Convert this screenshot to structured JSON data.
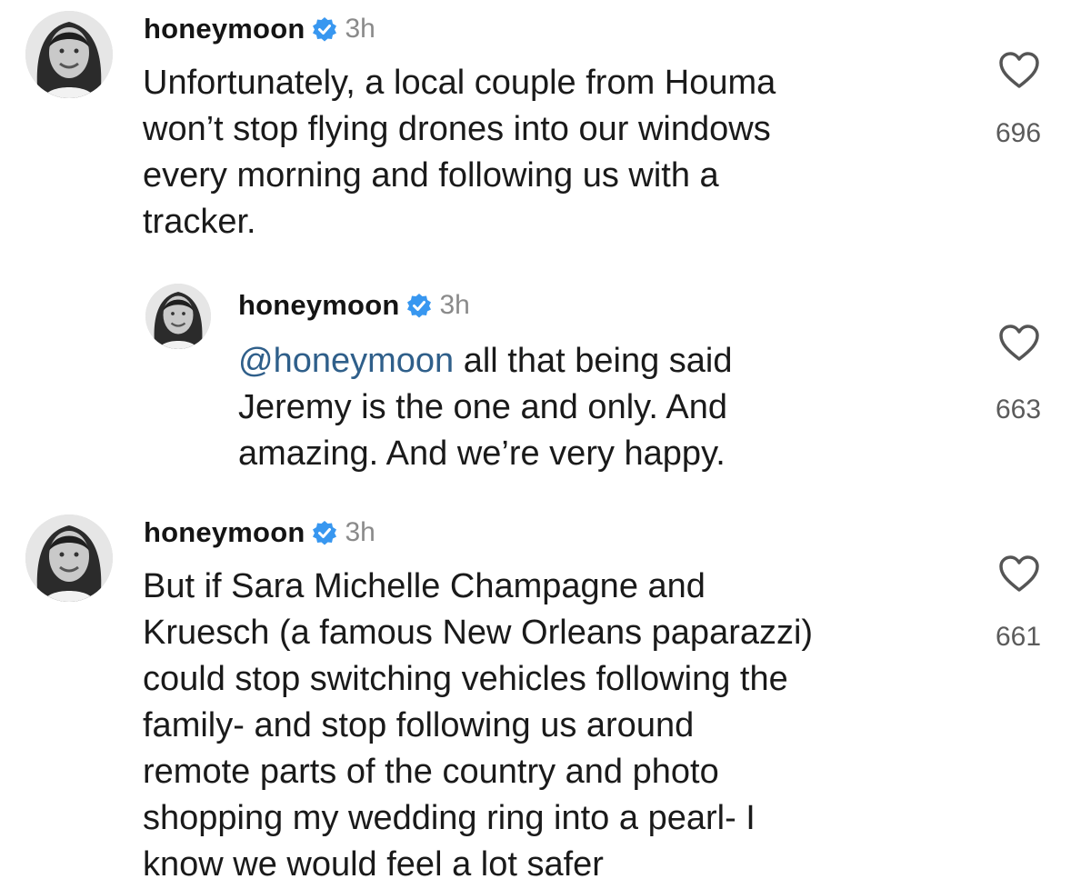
{
  "colors": {
    "verified_badge": "#3897f0",
    "mention": "#2f5f8a",
    "username": "#141414",
    "timestamp": "#8a8a8a",
    "like_count": "#5b5b5b"
  },
  "comments": [
    {
      "username": "honeymoon",
      "verified_icon": "verified-badge-icon",
      "time": "3h",
      "lines": [
        "Unfortunately, a local couple from Houma",
        "won’t stop flying drones into our windows",
        "every morning and following us with a",
        "tracker."
      ],
      "like_icon": "heart-outline-icon",
      "likes": "696"
    },
    {
      "username": "honeymoon",
      "verified_icon": "verified-badge-icon",
      "time": "3h",
      "mention": "@honeymoon",
      "first_line_rest": " all that being said",
      "lines": [
        "Jeremy is the one and only. And",
        "amazing. And we’re very happy."
      ],
      "like_icon": "heart-outline-icon",
      "likes": "663"
    },
    {
      "username": "honeymoon",
      "verified_icon": "verified-badge-icon",
      "time": "3h",
      "lines": [
        "But if Sara Michelle Champagne and",
        "Kruesch (a famous New Orleans paparazzi)",
        "could stop switching vehicles following the",
        "family- and  stop following us around",
        "remote parts of the country and photo",
        "shopping my wedding ring into a pearl- I",
        "know we would feel a lot safer"
      ],
      "like_icon": "heart-outline-icon",
      "likes": "661"
    }
  ]
}
